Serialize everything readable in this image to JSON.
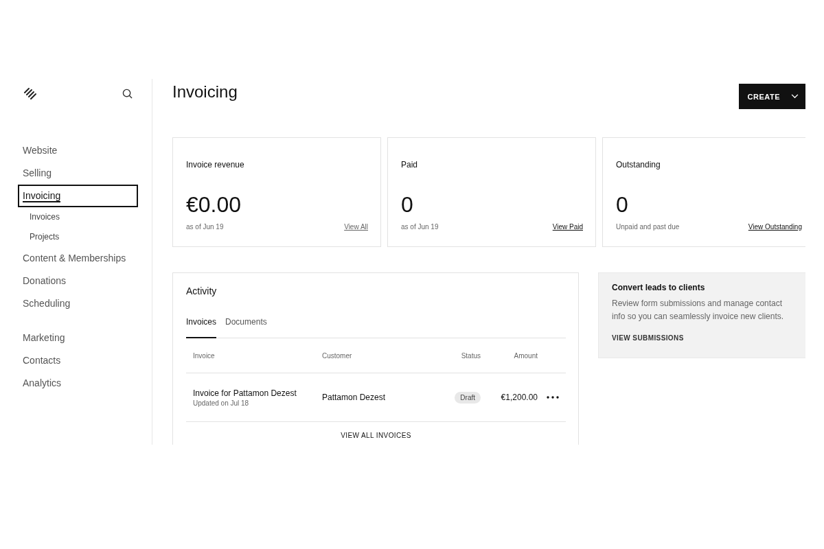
{
  "sidebar": {
    "groups": [
      {
        "items": [
          {
            "label": "Website",
            "selected": false
          },
          {
            "label": "Selling",
            "selected": false
          },
          {
            "label": "Invoicing",
            "selected": true,
            "children": [
              {
                "label": "Invoices",
                "selected": false
              },
              {
                "label": "Projects",
                "selected": false
              }
            ]
          },
          {
            "label": "Content & Memberships",
            "selected": false
          },
          {
            "label": "Donations",
            "selected": false
          },
          {
            "label": "Scheduling",
            "selected": false
          }
        ]
      },
      {
        "items": [
          {
            "label": "Marketing",
            "selected": false
          },
          {
            "label": "Contacts",
            "selected": false
          },
          {
            "label": "Analytics",
            "selected": false
          }
        ]
      }
    ]
  },
  "page": {
    "title": "Invoicing",
    "create_button": "CREATE"
  },
  "stats": [
    {
      "label": "Invoice revenue",
      "value": "€0.00",
      "note": "as of Jun 19",
      "link": "View All",
      "link_muted": true
    },
    {
      "label": "Paid",
      "value": "0",
      "note": "as of Jun 19",
      "link": "View Paid",
      "link_muted": false
    },
    {
      "label": "Outstanding",
      "value": "0",
      "note": "Unpaid and past due",
      "link": "View Outstanding",
      "link_muted": false
    }
  ],
  "activity": {
    "title": "Activity",
    "tabs": [
      {
        "label": "Invoices",
        "selected": true
      },
      {
        "label": "Documents",
        "selected": false
      }
    ],
    "columns": [
      "Invoice",
      "Customer",
      "Status",
      "Amount"
    ],
    "rows": [
      {
        "invoice": "Invoice for Pattamon Dezest",
        "updated": "Updated on Jul 18",
        "customer": "Pattamon Dezest",
        "status": "Draft",
        "amount": "€1,200.00"
      }
    ],
    "footer_link": "VIEW ALL INVOICES"
  },
  "promo": {
    "title": "Convert leads to clients",
    "text": "Review form submissions and manage contact info so you can seamlessly invoice new clients.",
    "link": "VIEW SUBMISSIONS"
  }
}
